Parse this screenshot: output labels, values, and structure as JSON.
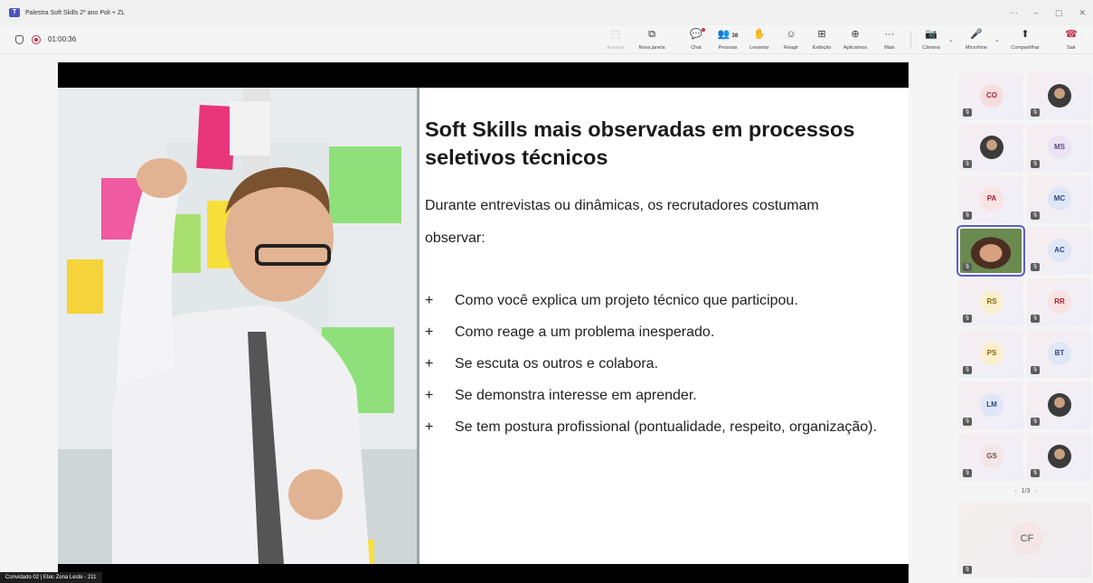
{
  "window": {
    "title": "Palestra Soft Skills 2º ano Poli + ZL",
    "controls": [
      "···",
      "–",
      "▢",
      "✕"
    ]
  },
  "toolbar": {
    "timer": "01:00:36",
    "buttons": [
      {
        "id": "assumir",
        "label": "Assumir",
        "icon": "⬚",
        "disabled": true
      },
      {
        "id": "nova-janela",
        "label": "Nova janela",
        "icon": "⧉"
      },
      {
        "id": "chat",
        "label": "Chat",
        "icon": "💬"
      },
      {
        "id": "pessoas",
        "label": "Pessoas",
        "icon": "👥",
        "count": "38"
      },
      {
        "id": "levantar",
        "label": "Levantar",
        "icon": "✋"
      },
      {
        "id": "reagir",
        "label": "Reagir",
        "icon": "☺"
      },
      {
        "id": "exibicao",
        "label": "Exibição",
        "icon": "⊞"
      },
      {
        "id": "aplicativos",
        "label": "Aplicativos",
        "icon": "⊕"
      },
      {
        "id": "mais",
        "label": "Mais",
        "icon": "···"
      },
      {
        "id": "camera",
        "label": "Câmera",
        "icon": "📷"
      },
      {
        "id": "microfone",
        "label": "Microfone",
        "icon": "🎤"
      },
      {
        "id": "compartilhar",
        "label": "Compartilhar",
        "icon": "⬆"
      },
      {
        "id": "sair",
        "label": "Sair",
        "icon": "☎"
      }
    ]
  },
  "slide": {
    "title": "Soft Skills mais observadas em processos seletivos técnicos",
    "intro": "Durante entrevistas ou dinâmicas, os recrutadores costumam observar:",
    "bullet_marker": "+",
    "bullets": [
      "Como você explica um projeto técnico que participou.",
      "Como reage a um problema inesperado.",
      "Se escuta os outros e colabora.",
      "Se demonstra interesse em aprender.",
      "Se tem postura profissional (pontualidade, respeito, organização)."
    ]
  },
  "presenter_label": "Convidado 02 | Etec Zona Leste - 211",
  "participants": [
    {
      "initials": "CO",
      "color": "#f6dede",
      "text_color": "#a4262c"
    },
    {
      "initials": "",
      "photo": true
    },
    {
      "initials": "",
      "photo": true
    },
    {
      "initials": "MS",
      "color": "#ece4f4",
      "text_color": "#5c4a80"
    },
    {
      "initials": "PA",
      "color": "#f8e2e2",
      "text_color": "#a4262c"
    },
    {
      "initials": "MC",
      "color": "#dfe6f6",
      "text_color": "#2b4a86"
    },
    {
      "initials": "",
      "photo": true,
      "active": true
    },
    {
      "initials": "AC",
      "color": "#dfe6f6",
      "text_color": "#2b4a86"
    },
    {
      "initials": "RS",
      "color": "#faf0d0",
      "text_color": "#8a6a00"
    },
    {
      "initials": "RR",
      "color": "#f8e2e2",
      "text_color": "#a4262c"
    },
    {
      "initials": "PS",
      "color": "#faf0d0",
      "text_color": "#8a6a00"
    },
    {
      "initials": "BT",
      "color": "#dfe6f6",
      "text_color": "#2b4a86"
    },
    {
      "initials": "LM",
      "color": "#dfe6f6",
      "text_color": "#2b4a86"
    },
    {
      "initials": "",
      "photo": true
    },
    {
      "initials": "GS",
      "color": "#f3e6e6",
      "text_color": "#7a4a4a"
    },
    {
      "initials": "",
      "photo": true
    }
  ],
  "pager": {
    "prev": "‹",
    "label": "1/3",
    "next": "›"
  },
  "self_view": {
    "initials": "CF"
  },
  "mic_off_icon": "🎙"
}
